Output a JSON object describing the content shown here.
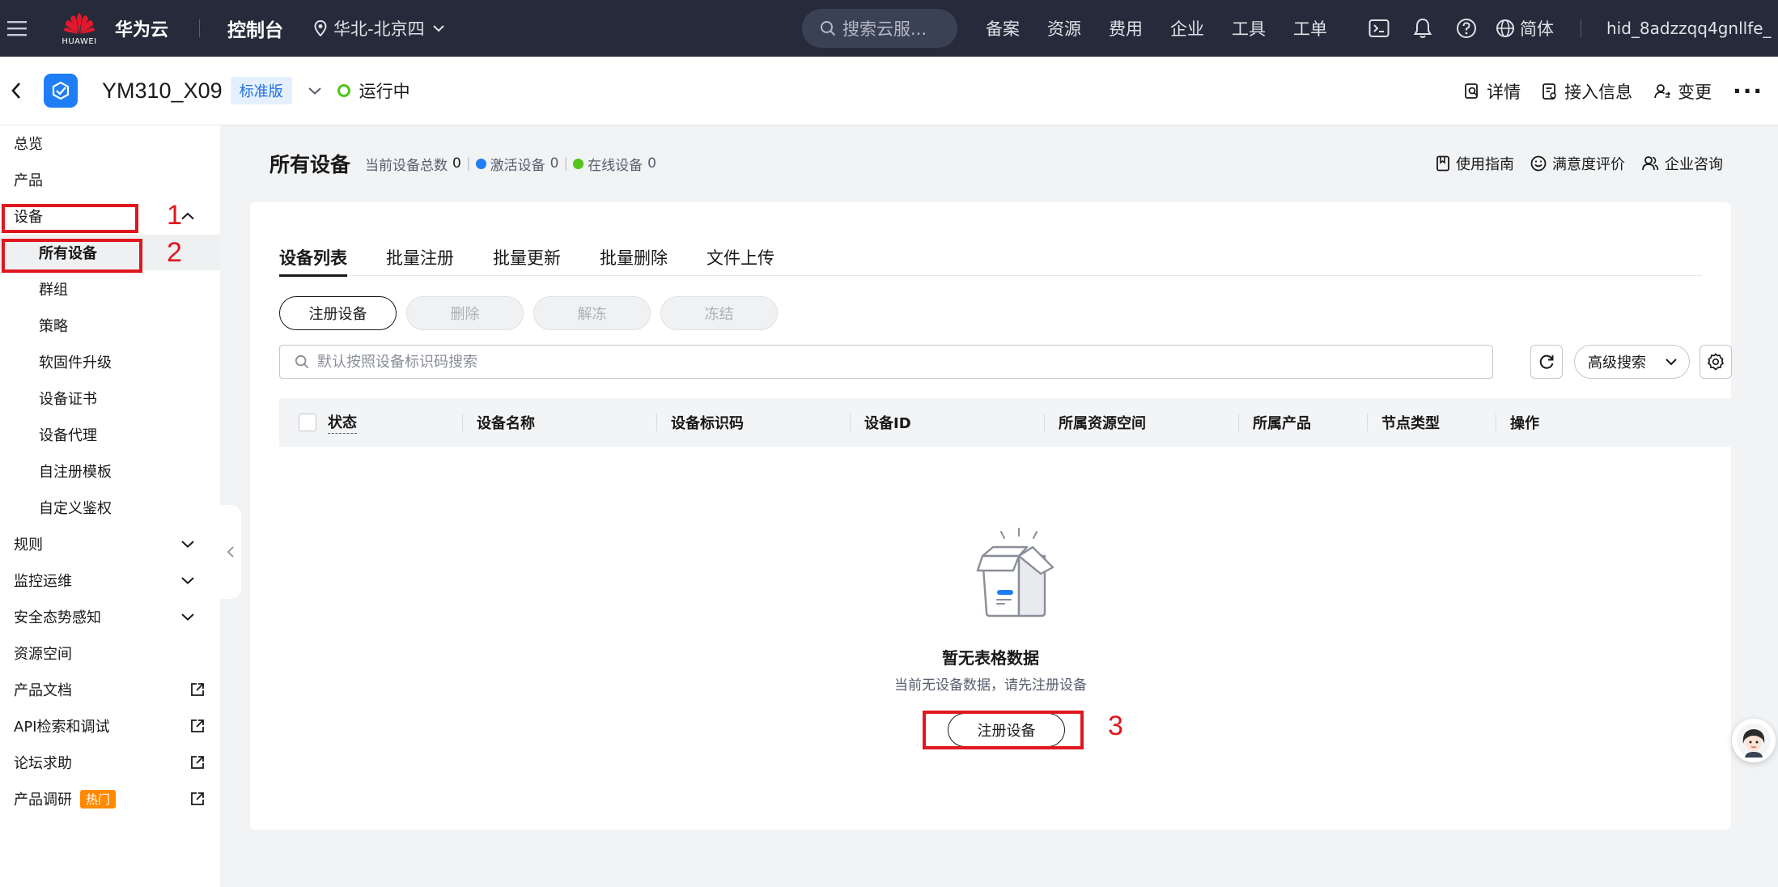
{
  "topbar": {
    "brand_name": "华为云",
    "brand_sub": "HUAWEI",
    "console": "控制台",
    "region": "华北-北京四",
    "search_placeholder": "搜索云服...",
    "nav": [
      "备案",
      "资源",
      "费用",
      "企业",
      "工具",
      "工单"
    ],
    "language": "简体",
    "user": "hid_8adzzqq4gnllfe_"
  },
  "instance": {
    "name": "YM310_X09",
    "edition": "标准版",
    "status": "运行中",
    "actions": [
      "详情",
      "接入信息",
      "变更"
    ],
    "more": "···"
  },
  "sidebar": {
    "items": [
      {
        "label": "总览"
      },
      {
        "label": "产品"
      },
      {
        "label": "设备"
      },
      {
        "label": "所有设备"
      },
      {
        "label": "群组"
      },
      {
        "label": "策略"
      },
      {
        "label": "软固件升级"
      },
      {
        "label": "设备证书"
      },
      {
        "label": "设备代理"
      },
      {
        "label": "自注册模板"
      },
      {
        "label": "自定义鉴权"
      },
      {
        "label": "规则"
      },
      {
        "label": "监控运维"
      },
      {
        "label": "安全态势感知"
      },
      {
        "label": "资源空间"
      },
      {
        "label": "产品文档"
      },
      {
        "label": "API检索和调试"
      },
      {
        "label": "论坛求助"
      },
      {
        "label": "产品调研"
      }
    ],
    "hot_badge": "热门"
  },
  "annotations": [
    "1",
    "2",
    "3"
  ],
  "page": {
    "title": "所有设备",
    "total_label": "当前设备总数",
    "total_value": "0",
    "active_label": "激活设备",
    "active_value": "0",
    "online_label": "在线设备",
    "online_value": "0",
    "help_links": [
      "使用指南",
      "满意度评价",
      "企业咨询"
    ]
  },
  "tabs": [
    "设备列表",
    "批量注册",
    "批量更新",
    "批量删除",
    "文件上传"
  ],
  "buttons": {
    "register": "注册设备",
    "delete": "删除",
    "unfreeze": "解冻",
    "freeze": "冻结"
  },
  "search": {
    "placeholder": "默认按照设备标识码搜索",
    "advanced": "高级搜索"
  },
  "table": {
    "columns": [
      "状态",
      "设备名称",
      "设备标识码",
      "设备ID",
      "所属资源空间",
      "所属产品",
      "节点类型",
      "操作"
    ]
  },
  "empty": {
    "title": "暂无表格数据",
    "description": "当前无设备数据，请先注册设备",
    "button": "注册设备"
  },
  "colors": {
    "topbar_bg": "#252b3a",
    "accent_blue": "#1f7ef5",
    "status_green": "#52c41a",
    "annotation_red": "#e0171f",
    "hot_orange": "#ff8a00"
  }
}
